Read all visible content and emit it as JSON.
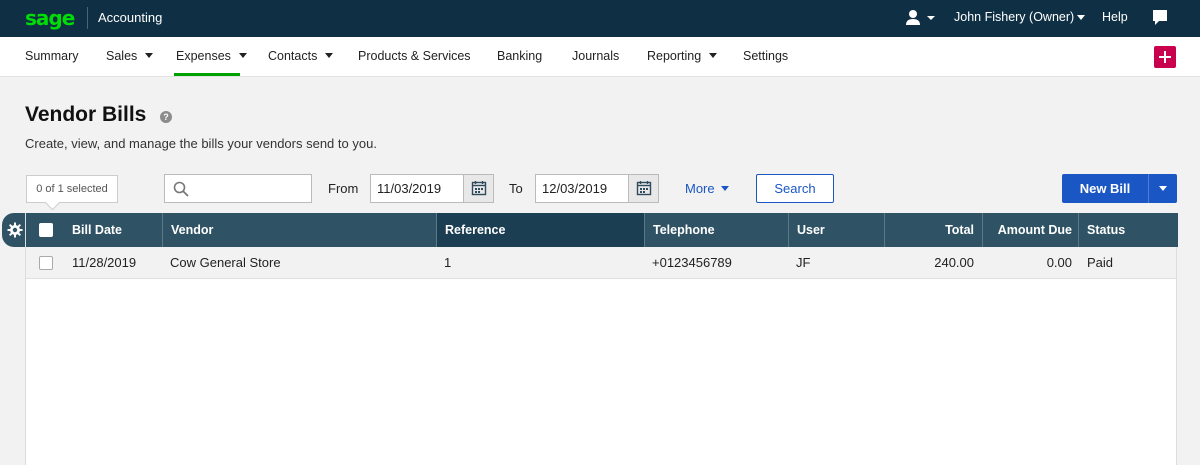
{
  "topbar": {
    "brand": "sage",
    "app_name": "Accounting",
    "user_name": "John Fishery (Owner)",
    "help": "Help"
  },
  "nav": {
    "items": [
      "Summary",
      "Sales",
      "Expenses",
      "Contacts",
      "Products & Services",
      "Banking",
      "Journals",
      "Reporting",
      "Settings"
    ],
    "active": "Expenses"
  },
  "page": {
    "title": "Vendor Bills",
    "subtitle": "Create, view, and manage the bills your vendors send to you."
  },
  "filters": {
    "selected_count": "0 of 1 selected",
    "search_value": "",
    "from_label": "From",
    "from_date": "11/03/2019",
    "to_label": "To",
    "to_date": "12/03/2019",
    "more": "More",
    "search_button": "Search",
    "new_bill": "New Bill"
  },
  "table": {
    "columns": [
      "Bill Date",
      "Vendor",
      "Reference",
      "Telephone",
      "User",
      "Total",
      "Amount Due",
      "Status"
    ],
    "rows": [
      {
        "bill_date": "11/28/2019",
        "vendor": "Cow General Store",
        "reference": "1",
        "telephone": "+0123456789",
        "user": "JF",
        "total": "240.00",
        "amount_due": "0.00",
        "status": "Paid"
      }
    ]
  },
  "icons": {
    "user": "user-icon",
    "chat": "chat-icon",
    "add": "plus-icon",
    "help": "question-icon",
    "search": "search-icon",
    "calendar": "calendar-icon",
    "settings": "gear-icon"
  },
  "colors": {
    "topbar": "#0f3044",
    "brand": "#00dc06",
    "nav_active": "#00a000",
    "primary": "#1a56c4",
    "add_button": "#c8004e",
    "table_header": "#2f5364"
  }
}
